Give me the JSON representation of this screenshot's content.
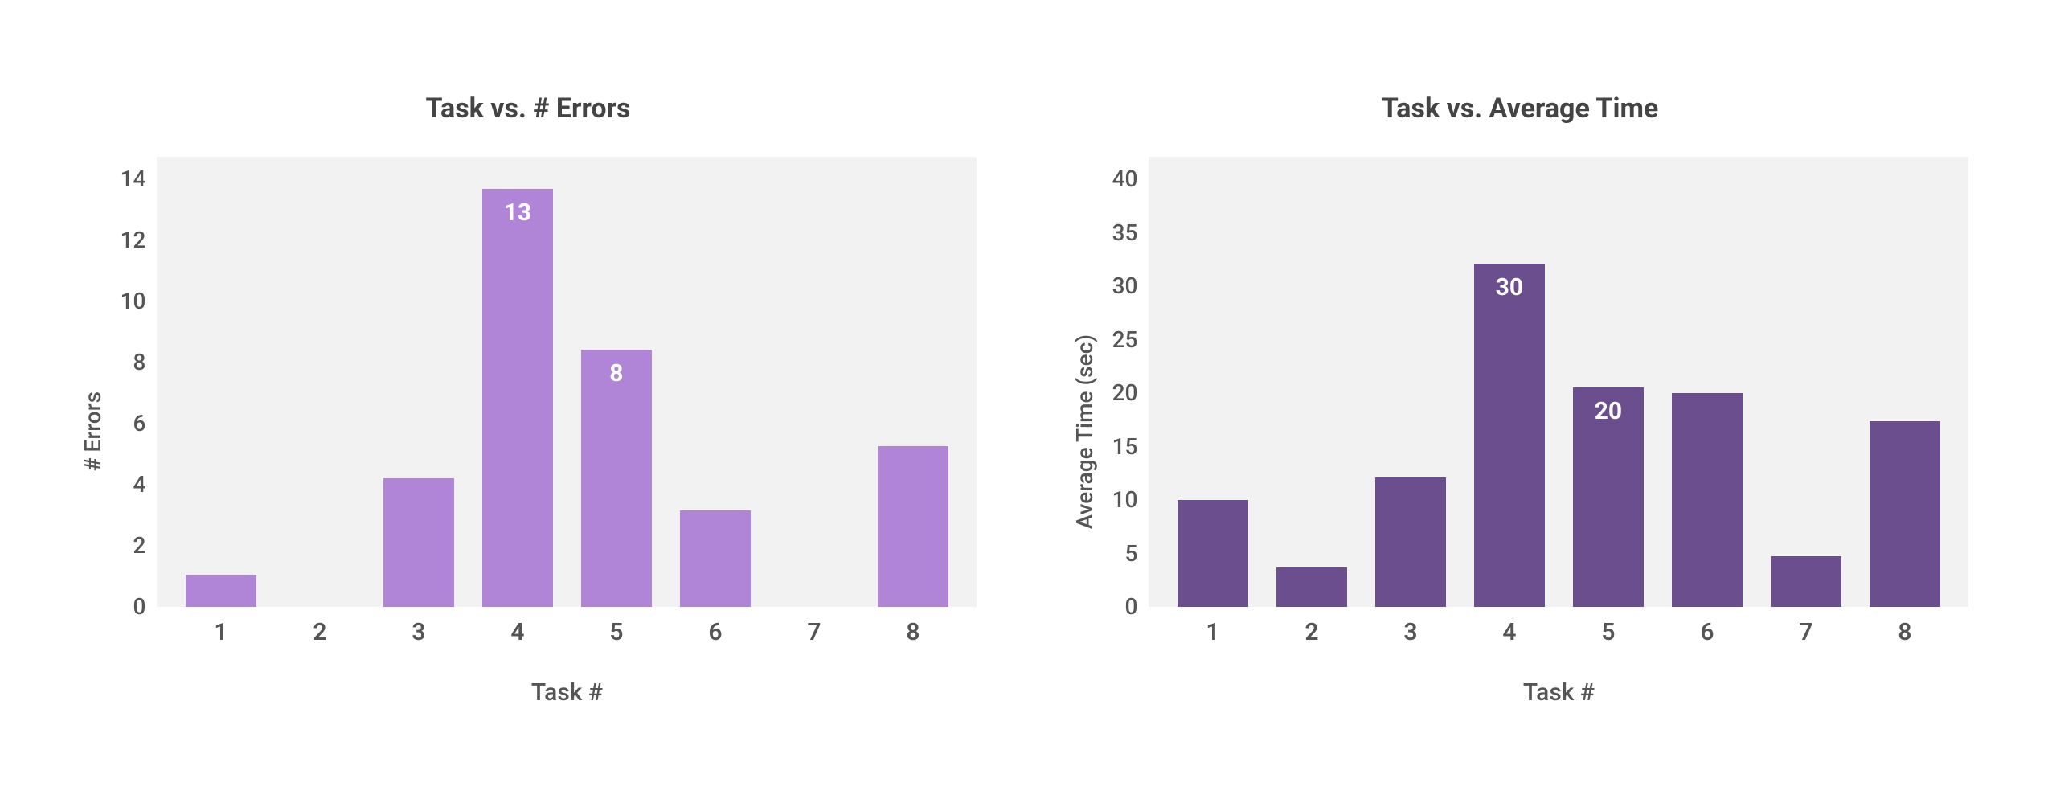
{
  "chart_data": [
    {
      "type": "bar",
      "title": "Task vs. # Errors",
      "xlabel": "Task #",
      "ylabel": "# Errors",
      "ylim": [
        0,
        14
      ],
      "yticks": [
        0,
        2,
        4,
        6,
        8,
        10,
        12,
        14
      ],
      "categories": [
        "1",
        "2",
        "3",
        "4",
        "5",
        "6",
        "7",
        "8"
      ],
      "values": [
        1,
        0,
        4,
        13,
        8,
        3,
        0,
        5
      ],
      "data_labels": {
        "3": "13",
        "4": "8"
      },
      "bar_color": "#b085d8",
      "plot_bg": "#f2f2f2"
    },
    {
      "type": "bar",
      "title": "Task vs. Average Time",
      "xlabel": "Task #",
      "ylabel": "Average Time (sec)",
      "ylim": [
        0,
        40
      ],
      "yticks": [
        0,
        5,
        10,
        15,
        20,
        25,
        30,
        35,
        40
      ],
      "categories": [
        "1",
        "2",
        "3",
        "4",
        "5",
        "6",
        "7",
        "8"
      ],
      "values": [
        9.5,
        3.5,
        11.5,
        30.5,
        19.5,
        19,
        4.5,
        16.5
      ],
      "data_labels": {
        "3": "30",
        "4": "20"
      },
      "bar_color": "#6b4e8e",
      "plot_bg": "#f2f2f2"
    }
  ]
}
